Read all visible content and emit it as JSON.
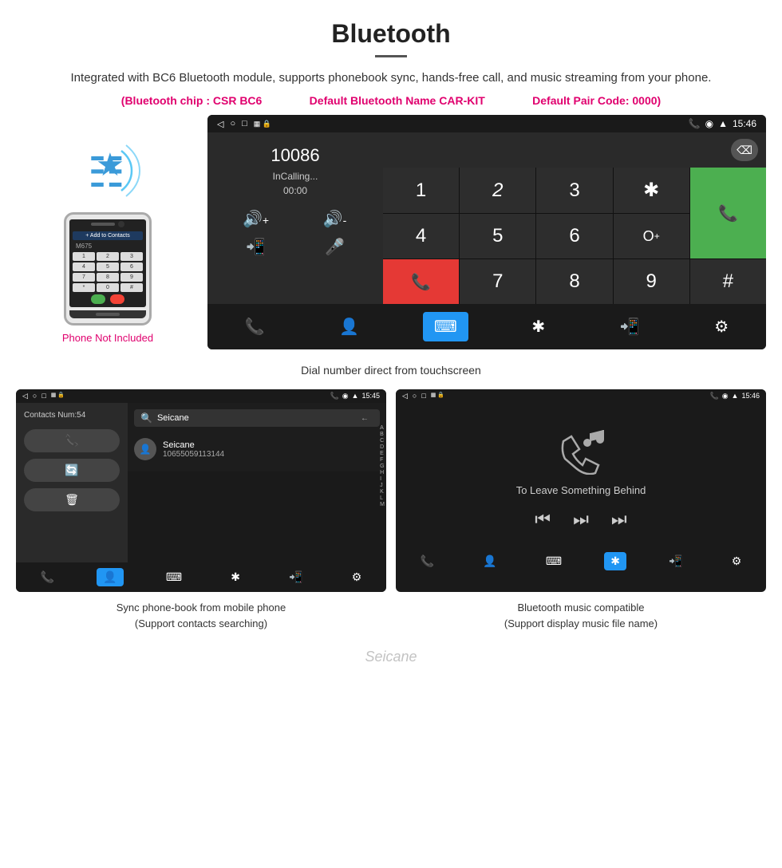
{
  "header": {
    "title": "Bluetooth",
    "description": "Integrated with BC6 Bluetooth module, supports phonebook sync, hands-free call, and music streaming from your phone.",
    "specs": {
      "chip": "(Bluetooth chip : CSR BC6",
      "name": "Default Bluetooth Name CAR-KIT",
      "pair": "Default Pair Code: 0000)"
    }
  },
  "dial_screen": {
    "status_bar": {
      "back_icon": "◁",
      "circle_icon": "○",
      "square_icon": "□",
      "sim_icon": "▦",
      "battery_icon": "🔋",
      "phone_icon": "📞",
      "location_icon": "◉",
      "wifi_icon": "▲",
      "time": "15:46"
    },
    "number": "10086",
    "status": "InCalling...",
    "timer": "00:00",
    "vol_up": "🔊+",
    "vol_down": "🔊-",
    "transfer": "📲",
    "mic": "🎤",
    "numpad": [
      "1",
      "2",
      "3",
      "*",
      "4",
      "5",
      "6",
      "0+",
      "7",
      "8",
      "9",
      "#"
    ],
    "delete_btn": "⌫",
    "call_btn": "📞",
    "end_btn": "📞",
    "bottom_bar": {
      "phone": "📞",
      "contact": "👤",
      "dialpad": "⌨",
      "bluetooth": "✱",
      "transfer": "📲",
      "settings": "⚙"
    }
  },
  "caption_dial": "Dial number direct from touchscreen",
  "contacts_screen": {
    "contacts_num": "Contacts Num:54",
    "search_placeholder": "Seicane",
    "contact_number": "10655059113144",
    "actions": {
      "call": "📞",
      "refresh": "🔄",
      "delete": "🗑"
    },
    "alphabet": [
      "A",
      "B",
      "C",
      "D",
      "E",
      "F",
      "G",
      "H",
      "I",
      "J",
      "K",
      "L",
      "M"
    ],
    "bottom_bar": {
      "phone": "📞",
      "contact": "👤",
      "dialpad": "⌨",
      "bluetooth": "✱",
      "transfer": "📲",
      "settings": "⚙"
    }
  },
  "music_screen": {
    "song_title": "To Leave Something Behind",
    "controls": {
      "prev": "⏮",
      "play": "⏭",
      "next": "⏭"
    },
    "bottom_bar": {
      "phone": "📞",
      "contact": "👤",
      "dialpad": "⌨",
      "bluetooth": "✱",
      "transfer": "📲",
      "settings": "⚙"
    }
  },
  "caption_contacts_line1": "Sync phone-book from mobile phone",
  "caption_contacts_line2": "(Support contacts searching)",
  "caption_music_line1": "Bluetooth music compatible",
  "caption_music_line2": "(Support display music file name)",
  "phone_label": "Phone Not Included",
  "watermark": "Seicane"
}
